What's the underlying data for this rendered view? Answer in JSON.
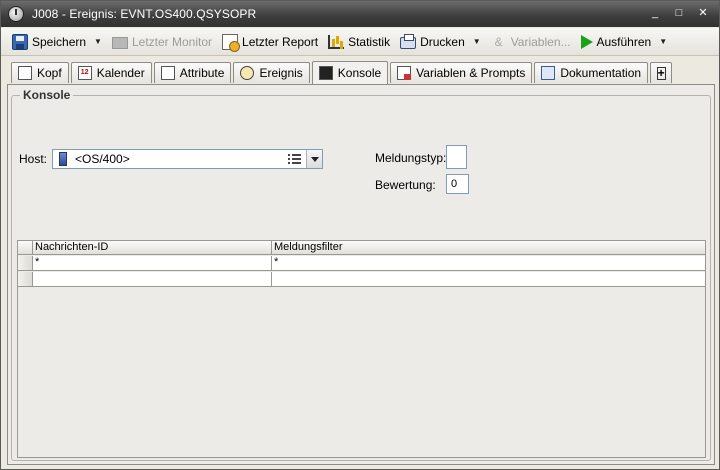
{
  "window": {
    "title": "J008 - Ereignis: EVNT.OS400.QSYSOPR",
    "minimize_glyph": "_",
    "maximize_glyph": "□",
    "close_glyph": "✕"
  },
  "toolbar": {
    "save_label": "Speichern",
    "monitor_label": "Letzter Monitor",
    "report_label": "Letzter Report",
    "statistic_label": "Statistik",
    "print_label": "Drucken",
    "variables_label": "Variablen...",
    "run_label": "Ausführen"
  },
  "tabs": [
    {
      "label": "Kopf",
      "icon": "header-icon"
    },
    {
      "label": "Kalender",
      "icon": "calendar-icon",
      "icon_text": "12"
    },
    {
      "label": "Attribute",
      "icon": "attribute-icon"
    },
    {
      "label": "Ereignis",
      "icon": "clock-icon"
    },
    {
      "label": "Konsole",
      "icon": "console-icon",
      "active": true
    },
    {
      "label": "Variablen & Prompts",
      "icon": "variables-icon"
    },
    {
      "label": "Dokumentation",
      "icon": "documentation-icon"
    },
    {
      "label": "+",
      "icon": "add-tab-icon"
    }
  ],
  "console": {
    "group_title": "Konsole",
    "host_label": "Host:",
    "host_value": "<OS/400>",
    "message_type_label": "Meldungstyp:",
    "message_type_value": "",
    "rating_label": "Bewertung:",
    "rating_value": "0",
    "table": {
      "columns": [
        "Nachrichten-ID",
        "Meldungsfilter"
      ],
      "rows": [
        [
          "*",
          "*"
        ],
        [
          "",
          ""
        ]
      ]
    }
  },
  "colors": {
    "titlebar": "#3c3c3c",
    "run_icon": "#19a319",
    "field_border": "#7f9db9"
  }
}
